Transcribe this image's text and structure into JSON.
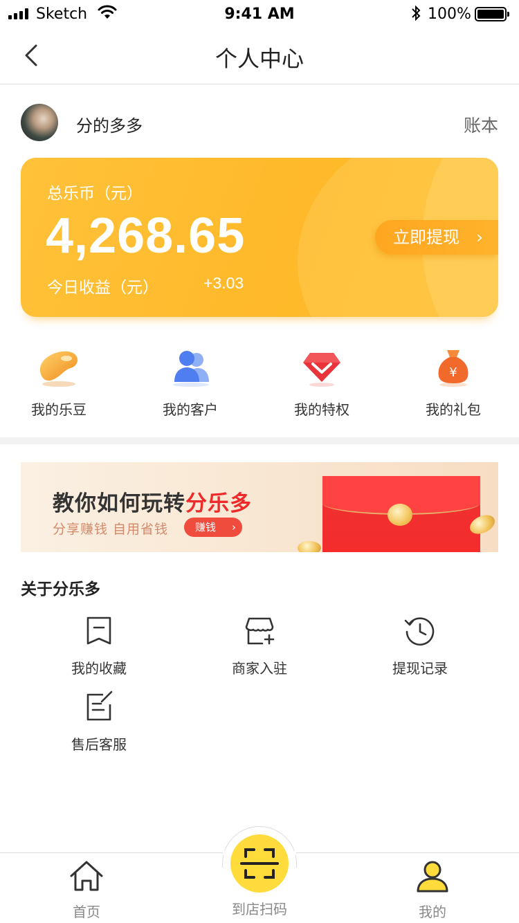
{
  "status_bar": {
    "carrier": "Sketch",
    "time": "9:41 AM",
    "battery": "100%"
  },
  "nav": {
    "title": "个人中心"
  },
  "user": {
    "name": "分的多多",
    "ledger_label": "账本"
  },
  "balance": {
    "label": "总乐币（元）",
    "amount": "4,268.65",
    "today_label": "今日收益（元）",
    "today_value": "+3.03",
    "withdraw_label": "立即提现",
    "accent": "#ffb92a"
  },
  "quick_actions": [
    {
      "label": "我的乐豆",
      "icon": "bean-icon"
    },
    {
      "label": "我的客户",
      "icon": "users-icon"
    },
    {
      "label": "我的特权",
      "icon": "diamond-icon"
    },
    {
      "label": "我的礼包",
      "icon": "money-bag-icon"
    }
  ],
  "banner": {
    "headline_prefix": "教你如何玩转",
    "headline_accent": "分乐多",
    "subtitle": "分享赚钱 自用省钱",
    "button_label": "赚钱"
  },
  "about": {
    "title": "关于分乐多",
    "items": [
      {
        "label": "我的收藏",
        "icon": "bookmark-icon"
      },
      {
        "label": "商家入驻",
        "icon": "store-add-icon"
      },
      {
        "label": "提现记录",
        "icon": "history-icon"
      },
      {
        "label": "售后客服",
        "icon": "edit-note-icon"
      }
    ]
  },
  "tab_bar": {
    "home": "首页",
    "scan": "到店扫码",
    "mine": "我的",
    "scan_color": "#ffdb3b"
  }
}
